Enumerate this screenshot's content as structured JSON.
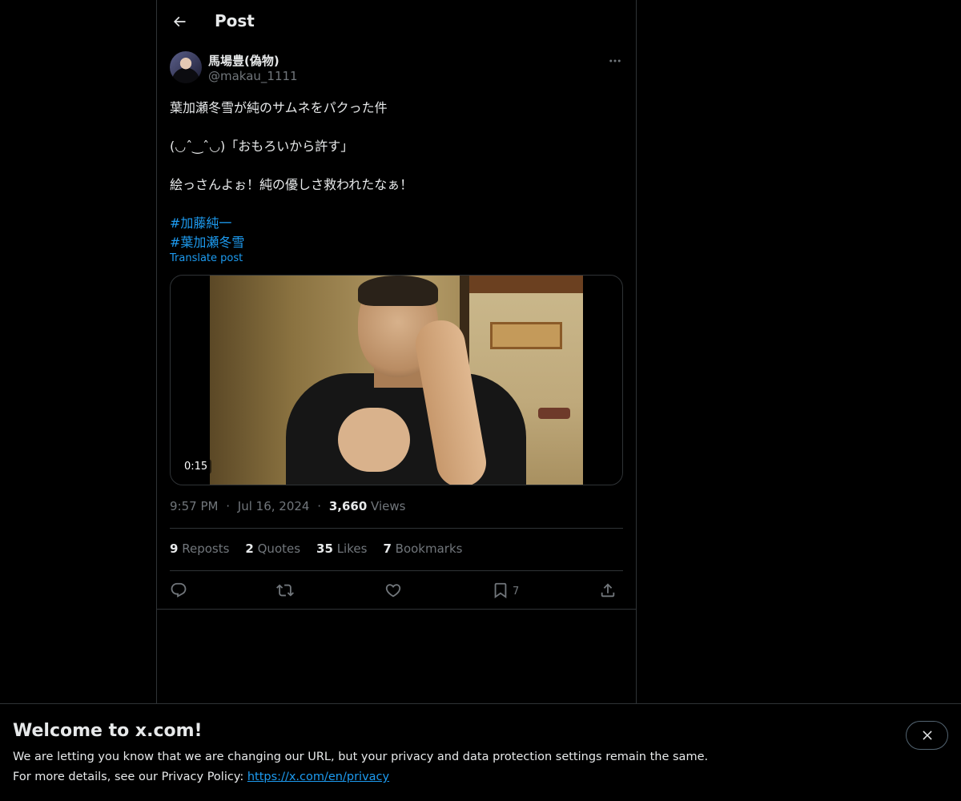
{
  "header": {
    "title": "Post",
    "back_icon": "arrow-left-icon"
  },
  "post": {
    "author": {
      "display_name": "馬場豊(偽物)",
      "handle": "@makau_1111"
    },
    "text_lines": [
      "葉加瀬冬雪が純のサムネをパクった件",
      "(◡ˆ‿ˆ◡)「おもろいから許す」",
      "絵っさんよぉ！純の優しさ救われたなぁ！"
    ],
    "hashtags": [
      "#加藤純一",
      "#葉加瀬冬雪"
    ],
    "translate_label": "Translate post",
    "video": {
      "duration": "0:15"
    },
    "time": "9:57 PM",
    "separator": "·",
    "date": "Jul 16, 2024",
    "views_count": "3,660",
    "views_label": "Views"
  },
  "stats": {
    "reposts_count": "9",
    "reposts_label": "Reposts",
    "quotes_count": "2",
    "quotes_label": "Quotes",
    "likes_count": "35",
    "likes_label": "Likes",
    "bookmarks_count": "7",
    "bookmarks_label": "Bookmarks"
  },
  "actions": {
    "reply_icon": "reply-icon",
    "repost_icon": "repost-icon",
    "like_icon": "heart-icon",
    "bookmark_icon": "bookmark-icon",
    "bookmark_count": "7",
    "share_icon": "share-icon"
  },
  "banner": {
    "title": "Welcome to x.com!",
    "text1": "We are letting you know that we are changing our URL, but your privacy and data protection settings remain the same.",
    "text2_prefix": "For more details, see our Privacy Policy: ",
    "link": "https://x.com/en/privacy"
  },
  "colors": {
    "background": "#000000",
    "text": "#e7e9ea",
    "muted": "#71767b",
    "accent": "#1d9bf0",
    "border": "#2f3336"
  }
}
